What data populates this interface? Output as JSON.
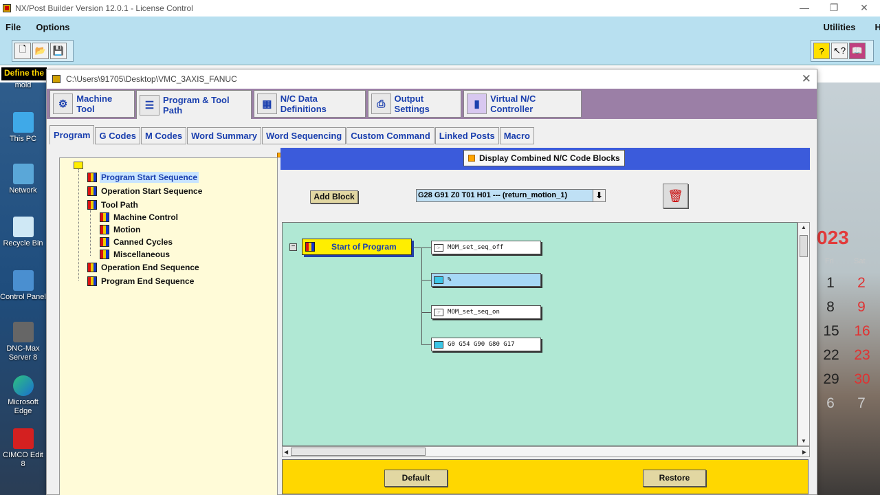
{
  "window": {
    "title": "NX/Post Builder Version 12.0.1  -  License Control",
    "minimize": "—",
    "maximize": "❐",
    "close": "✕"
  },
  "menu": {
    "left": [
      "File",
      "Options"
    ],
    "right": [
      "Utilities",
      "Help"
    ]
  },
  "toolbar": {
    "left_icons": [
      "new-file-icon",
      "open-folder-icon",
      "save-icon"
    ],
    "right_icons": [
      "help-balloon-icon",
      "context-help-icon",
      "manual-book-icon"
    ]
  },
  "tooltip_fragment": "Define the",
  "desktop": {
    "top_fragment": "mold",
    "icons": [
      {
        "label": "This PC",
        "icon": "computer-icon"
      },
      {
        "label": "Network",
        "icon": "network-icon"
      },
      {
        "label": "Recycle Bin",
        "icon": "recycle-bin-icon"
      },
      {
        "label": "Control Panel",
        "icon": "control-panel-icon"
      },
      {
        "label": "DNC-Max Server 8",
        "icon": "dnc-max-icon"
      },
      {
        "label": "Microsoft Edge",
        "icon": "edge-icon"
      },
      {
        "label": "CIMCO Edit 8",
        "icon": "cimco-icon"
      }
    ],
    "calendar": {
      "year_fragment": "023",
      "headers": [
        "Fri",
        "Sat"
      ],
      "rows": [
        [
          "1",
          "2"
        ],
        [
          "8",
          "9"
        ],
        [
          "15",
          "16"
        ],
        [
          "22",
          "23"
        ],
        [
          "29",
          "30"
        ],
        [
          "6",
          "7"
        ]
      ]
    }
  },
  "dialog": {
    "path": "C:\\Users\\91705\\Desktop\\VMC_3AXIS_FANUC",
    "close": "✕",
    "main_tabs": [
      {
        "label": "Machine Tool",
        "icon": "machine-tool-icon"
      },
      {
        "label": "Program & Tool Path",
        "icon": "program-tool-path-icon",
        "active": true
      },
      {
        "label": "N/C Data Definitions",
        "icon": "nc-data-icon"
      },
      {
        "label": "Output Settings",
        "icon": "printer-icon"
      },
      {
        "label": "Virtual N/C Controller",
        "icon": "virtual-nc-icon"
      }
    ],
    "sub_tabs": [
      "Program",
      "G Codes",
      "M Codes",
      "Word Summary",
      "Word Sequencing",
      "Custom Command",
      "Linked Posts",
      "Macro"
    ],
    "active_sub_tab": "Program",
    "tree": [
      {
        "label": "Program Start Sequence",
        "level": 1,
        "selected": true
      },
      {
        "label": "Operation Start Sequence",
        "level": 1
      },
      {
        "label": "Tool Path",
        "level": 1
      },
      {
        "label": "Machine Control",
        "level": 2
      },
      {
        "label": "Motion",
        "level": 2
      },
      {
        "label": "Canned Cycles",
        "level": 2
      },
      {
        "label": "Miscellaneous",
        "level": 2
      },
      {
        "label": "Operation End Sequence",
        "level": 1
      },
      {
        "label": "Program End Sequence",
        "level": 1
      }
    ],
    "combined_button": "Display Combined N/C Code Blocks",
    "add_block": "Add Block",
    "block_select": {
      "value": "G28 G91 Z0 T01 H01 --- (return_motion_1)",
      "arrow": "⬇"
    },
    "trash_icon": "trash-icon",
    "collapse_symbol": "−",
    "start_node": "Start of Program",
    "blocks": [
      {
        "text": "MOM_set_seq_off",
        "icon": "hand-pointer-icon",
        "highlight": false
      },
      {
        "text": "%",
        "icon": "cube-block-icon",
        "highlight": true
      },
      {
        "text": "MOM_set_seq_on",
        "icon": "hand-pointer-icon",
        "highlight": false
      },
      {
        "text": "G0  G54  G90  G80  G17",
        "icon": "cube-block-icon",
        "highlight": false
      }
    ],
    "scroll": {
      "up": "▲",
      "down": "▼",
      "left": "◀",
      "right": "▶"
    },
    "default_button": "Default",
    "restore_button": "Restore"
  }
}
